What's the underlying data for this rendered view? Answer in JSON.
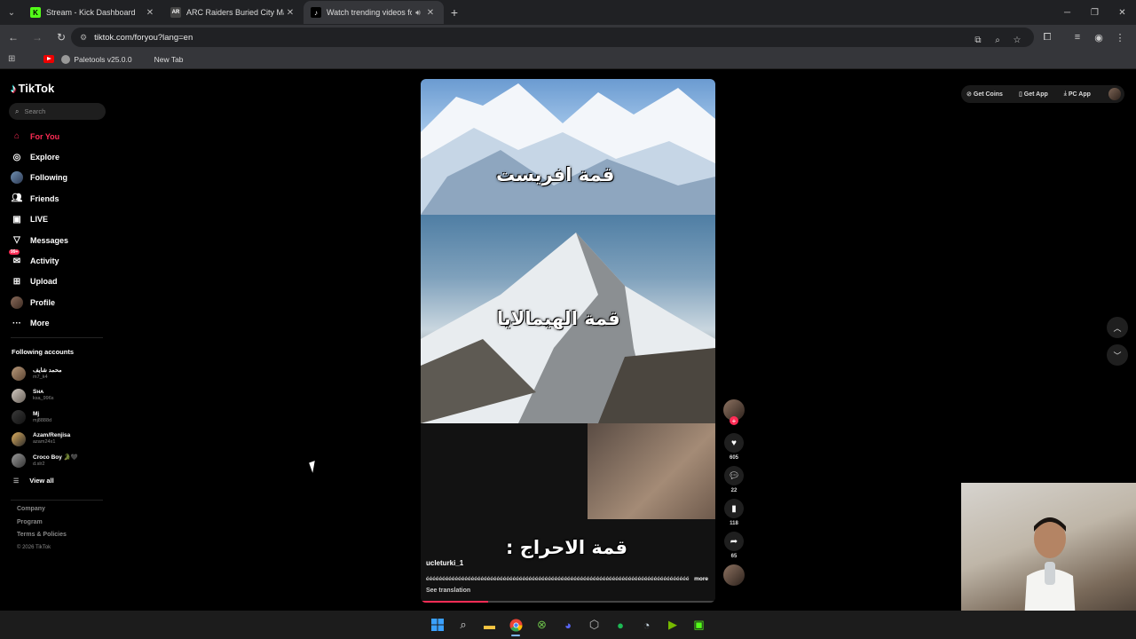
{
  "browser": {
    "tabs": [
      {
        "title": "Stream - Kick Dashboard",
        "active": false,
        "favicon_color": "#53fc18",
        "favicon_letter": "K"
      },
      {
        "title": "ARC Raiders Buried City Map - ",
        "active": false,
        "favicon_color": "#555555",
        "favicon_letter": "AR"
      },
      {
        "title": "Watch trending videos for y",
        "active": true,
        "favicon_color": "#000000",
        "favicon_letter": "♪"
      }
    ],
    "url": "tiktok.com/foryou?lang=en",
    "bookmarks": [
      {
        "label": "Paletools v25.0.0"
      },
      {
        "label": "New Tab"
      }
    ]
  },
  "tiktok": {
    "logo_text": "TikTok",
    "search_placeholder": "Search",
    "nav": [
      {
        "label": "For You",
        "icon": "home-icon",
        "active": true
      },
      {
        "label": "Explore",
        "icon": "compass-icon",
        "active": false
      },
      {
        "label": "Following",
        "icon": "following-icon",
        "active": false
      },
      {
        "label": "Friends",
        "icon": "friends-icon",
        "active": false
      },
      {
        "label": "LIVE",
        "icon": "live-icon",
        "active": false
      },
      {
        "label": "Messages",
        "icon": "messages-icon",
        "active": false
      },
      {
        "label": "Activity",
        "icon": "activity-icon",
        "active": false,
        "badge": "99+"
      },
      {
        "label": "Upload",
        "icon": "upload-icon",
        "active": false
      },
      {
        "label": "Profile",
        "icon": "profile-icon",
        "active": false
      },
      {
        "label": "More",
        "icon": "more-icon",
        "active": false
      }
    ],
    "following_title": "Following accounts",
    "following": [
      {
        "name": "محمد شايف",
        "handle": "m7_k4"
      },
      {
        "name": "Sʜᴀ",
        "handle": "ksa_996s"
      },
      {
        "name": "Mj",
        "handle": "mj8888d"
      },
      {
        "name": "Azam/Renjisa",
        "handle": "azam24x1"
      },
      {
        "name": "Croco Boy 🐊🖤",
        "handle": "d.slr2"
      }
    ],
    "view_all": "View all",
    "footer": [
      "Company",
      "Program",
      "Terms & Policies"
    ],
    "copyright": "© 2026 TikTok",
    "top_actions": {
      "coins": "Get Coins",
      "app": "Get App",
      "pc": "PC App"
    },
    "video": {
      "caption_top": "قمة افريست",
      "caption_mid": "قمة الهيمالايا",
      "caption_bottom": "قمة الاحراج :",
      "username": "ucleturki_1",
      "description": "éééééééééééééééééééééééééééééééééééééééééééééééééééééééééééééééééééééééééééééééééé",
      "more": "more",
      "see_translation": "See translation",
      "progress": 0.23
    },
    "counts": {
      "likes": "605",
      "comments": "22",
      "saves": "118",
      "shares": "65"
    }
  }
}
